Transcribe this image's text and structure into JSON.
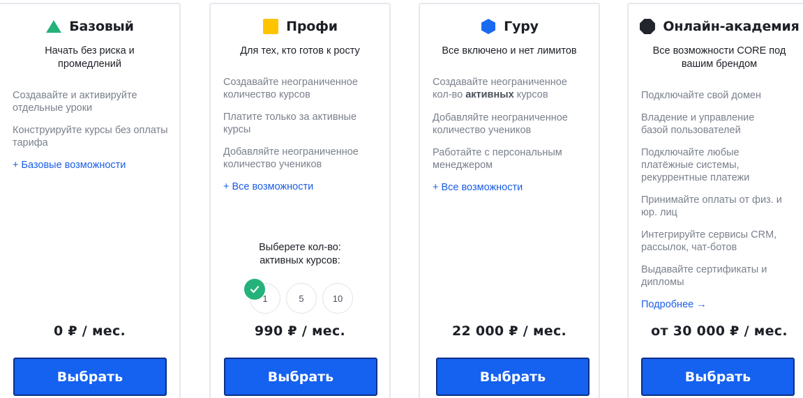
{
  "plans": [
    {
      "title": "Базовый",
      "icon": "green-triangle-icon",
      "subtitle": "Начать без риска и промедлений",
      "features": [
        "Создавайте и активируйте отдельные уроки",
        "Конструируйте курсы без оплаты тарифа"
      ],
      "link": "+ Базовые возможности",
      "price": "0 ₽ / мес.",
      "button": "Выбрать"
    },
    {
      "title": "Профи",
      "icon": "yellow-square-icon",
      "subtitle": "Для тех, кто готов к росту",
      "features": [
        "Создавайте неограниченное количество курсов",
        "Платите только за активные курсы",
        "Добавляйте неограниченное количество учеников"
      ],
      "link": "+ Все возможности",
      "choose_label": "Выберете кол-во: активных курсов:",
      "course_options": [
        "1",
        "5",
        "10"
      ],
      "selected_option": "1",
      "price": "990 ₽ / мес.",
      "button": "Выбрать"
    },
    {
      "title": "Гуру",
      "icon": "blue-hexagon-icon",
      "subtitle": "Все включено и нет лимитов",
      "features": [
        "Создавайте неограниченное",
        "кол-во",
        "активных",
        "курсов",
        "Добавляйте неограниченное количество учеников",
        "Работайте с персональным менеджером"
      ],
      "link": "+ Все возможности",
      "price": "22 000 ₽ / мес.",
      "button": "Выбрать"
    },
    {
      "title": "Онлайн-академия",
      "icon": "dark-octagon-icon",
      "subtitle": "Все возможности CORE под вашим брендом",
      "features": [
        "Подключайте свой домен",
        "Владение и управление базой пользователей",
        "Подключайте любые платёжные системы, рекуррентные платежи",
        "Принимайте оплаты от физ. и юр. лиц",
        "Интегрируйте сервисы CRM, рассылок, чат-ботов",
        "Выдавайте сертификаты и дипломы"
      ],
      "link": "Подробнее →",
      "price": "от 30 000 ₽ / мес.",
      "button": "Выбрать"
    }
  ],
  "colors": {
    "accent": "#1561f0",
    "link": "#1b5ee6",
    "green": "#25b27a",
    "yellow": "#ffc400",
    "blue": "#1a6af0",
    "dark": "#22252b"
  }
}
